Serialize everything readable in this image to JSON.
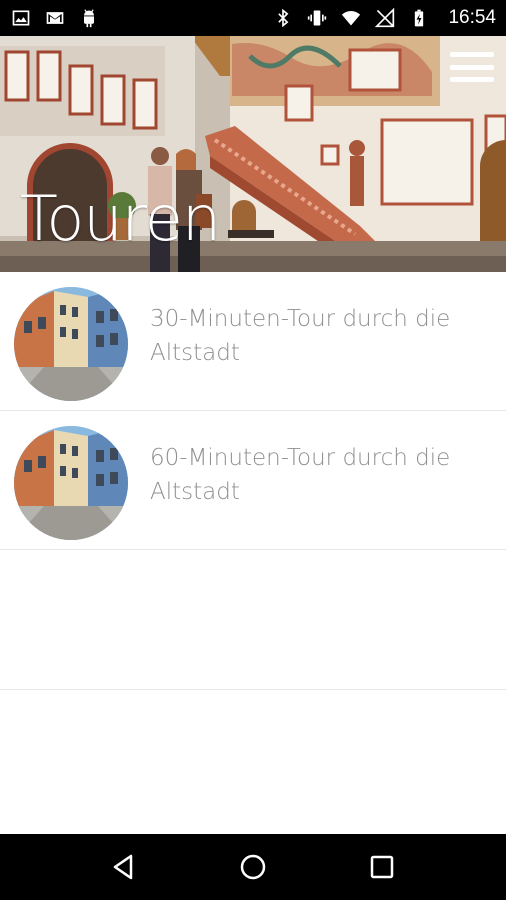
{
  "status_bar": {
    "time": "16:54",
    "left_icons": [
      "image-notification-icon",
      "gmail-icon",
      "android-icon"
    ],
    "right_icons": [
      "bluetooth-icon",
      "vibrate-icon",
      "wifi-icon",
      "no-sim-icon",
      "battery-charging-icon"
    ]
  },
  "header": {
    "title": "Touren"
  },
  "tours": [
    {
      "label": "30-Minuten-Tour durch die Altstadt"
    },
    {
      "label": "60-Minuten-Tour durch die Altstadt"
    }
  ],
  "nav": {
    "buttons": [
      "back-icon",
      "home-icon",
      "recents-icon"
    ]
  }
}
